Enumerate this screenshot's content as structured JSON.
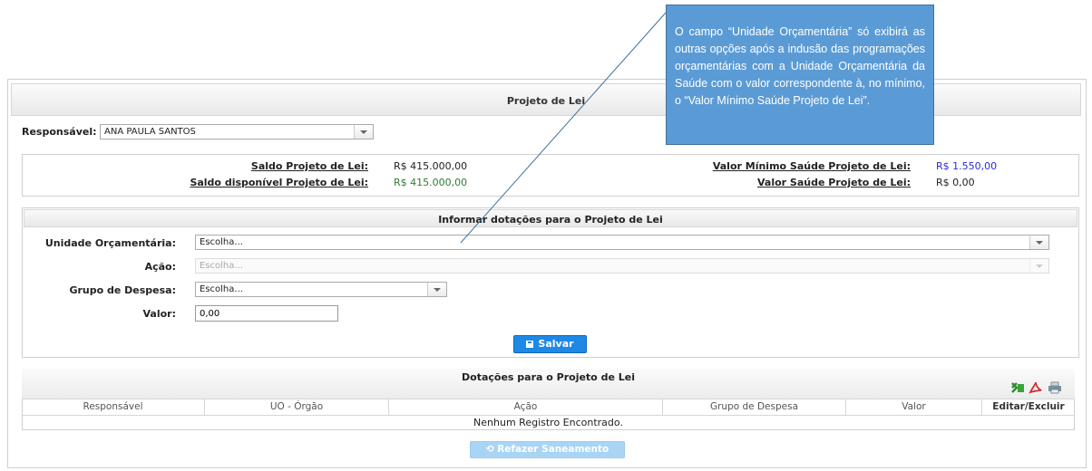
{
  "page": {
    "title": "Projeto de Lei"
  },
  "responsavel": {
    "label": "Responsável:",
    "value": "ANA PAULA SANTOS"
  },
  "saldo": {
    "saldo_label": "Saldo Projeto de Lei:",
    "saldo_value": "R$ 415.000,00",
    "disponivel_label": "Saldo disponível Projeto de Lei:",
    "disponivel_value": "R$ 415.000,00",
    "minimo_label": "Valor Mínimo Saúde Projeto de Lei:",
    "minimo_value": "R$ 1.550,00",
    "saude_label": "Valor Saúde Projeto de Lei:",
    "saude_value": "R$ 0,00",
    "disponivel_color": "#2e7d32",
    "minimo_color": "#2b2bd6"
  },
  "form": {
    "header": "Informar dotações para o Projeto de Lei",
    "unidade_label": "Unidade Orçamentária:",
    "unidade_value": "Escolha...",
    "acao_label": "Ação:",
    "acao_value": "Escolha...",
    "grupo_label": "Grupo de Despesa:",
    "grupo_value": "Escolha...",
    "valor_label": "Valor:",
    "valor_value": "0,00",
    "salvar_label": "Salvar"
  },
  "dotacoes": {
    "header": "Dotações para o Projeto de Lei",
    "columns": [
      "Responsável",
      "UO - Órgão",
      "Ação",
      "Grupo de Despesa",
      "Valor",
      "Editar/Excluir"
    ],
    "empty_message": "Nenhum Registro Encontrado.",
    "icons": [
      "excel-icon",
      "pdf-icon",
      "print-icon"
    ]
  },
  "refazer_label": "Refazer Saneamento",
  "tooltip": {
    "text": "O campo “Unidade Orçamentária” só exibirá as outras opções após a indusão das programações orçamentárias com a Unidade Orçamentária da Saúde com o valor correspondente à, no mínimo, o “Valor Mínimo Saúde Projeto de Lei”."
  }
}
